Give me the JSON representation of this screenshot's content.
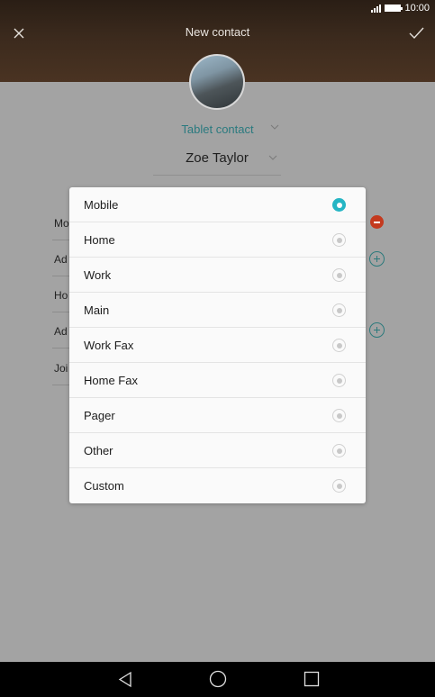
{
  "status_bar": {
    "time": "10:00"
  },
  "header": {
    "title": "New contact"
  },
  "form": {
    "account": "Tablet contact",
    "name": "Zoe Taylor",
    "partial_rows": [
      "Mo",
      "Ad",
      "Ho",
      "Ad",
      "Joi"
    ]
  },
  "dialog": {
    "options": [
      {
        "label": "Mobile",
        "selected": true
      },
      {
        "label": "Home",
        "selected": false
      },
      {
        "label": "Work",
        "selected": false
      },
      {
        "label": "Main",
        "selected": false
      },
      {
        "label": "Work Fax",
        "selected": false
      },
      {
        "label": "Home Fax",
        "selected": false
      },
      {
        "label": "Pager",
        "selected": false
      },
      {
        "label": "Other",
        "selected": false
      },
      {
        "label": "Custom",
        "selected": false
      }
    ]
  },
  "colors": {
    "accent": "#25b5c4",
    "remove": "#c43a1f",
    "link": "#2a7a7f"
  },
  "icons": {
    "close": "close-icon",
    "confirm": "check-icon",
    "back": "back-triangle-icon",
    "home": "home-circle-icon",
    "recents": "recents-square-icon"
  }
}
